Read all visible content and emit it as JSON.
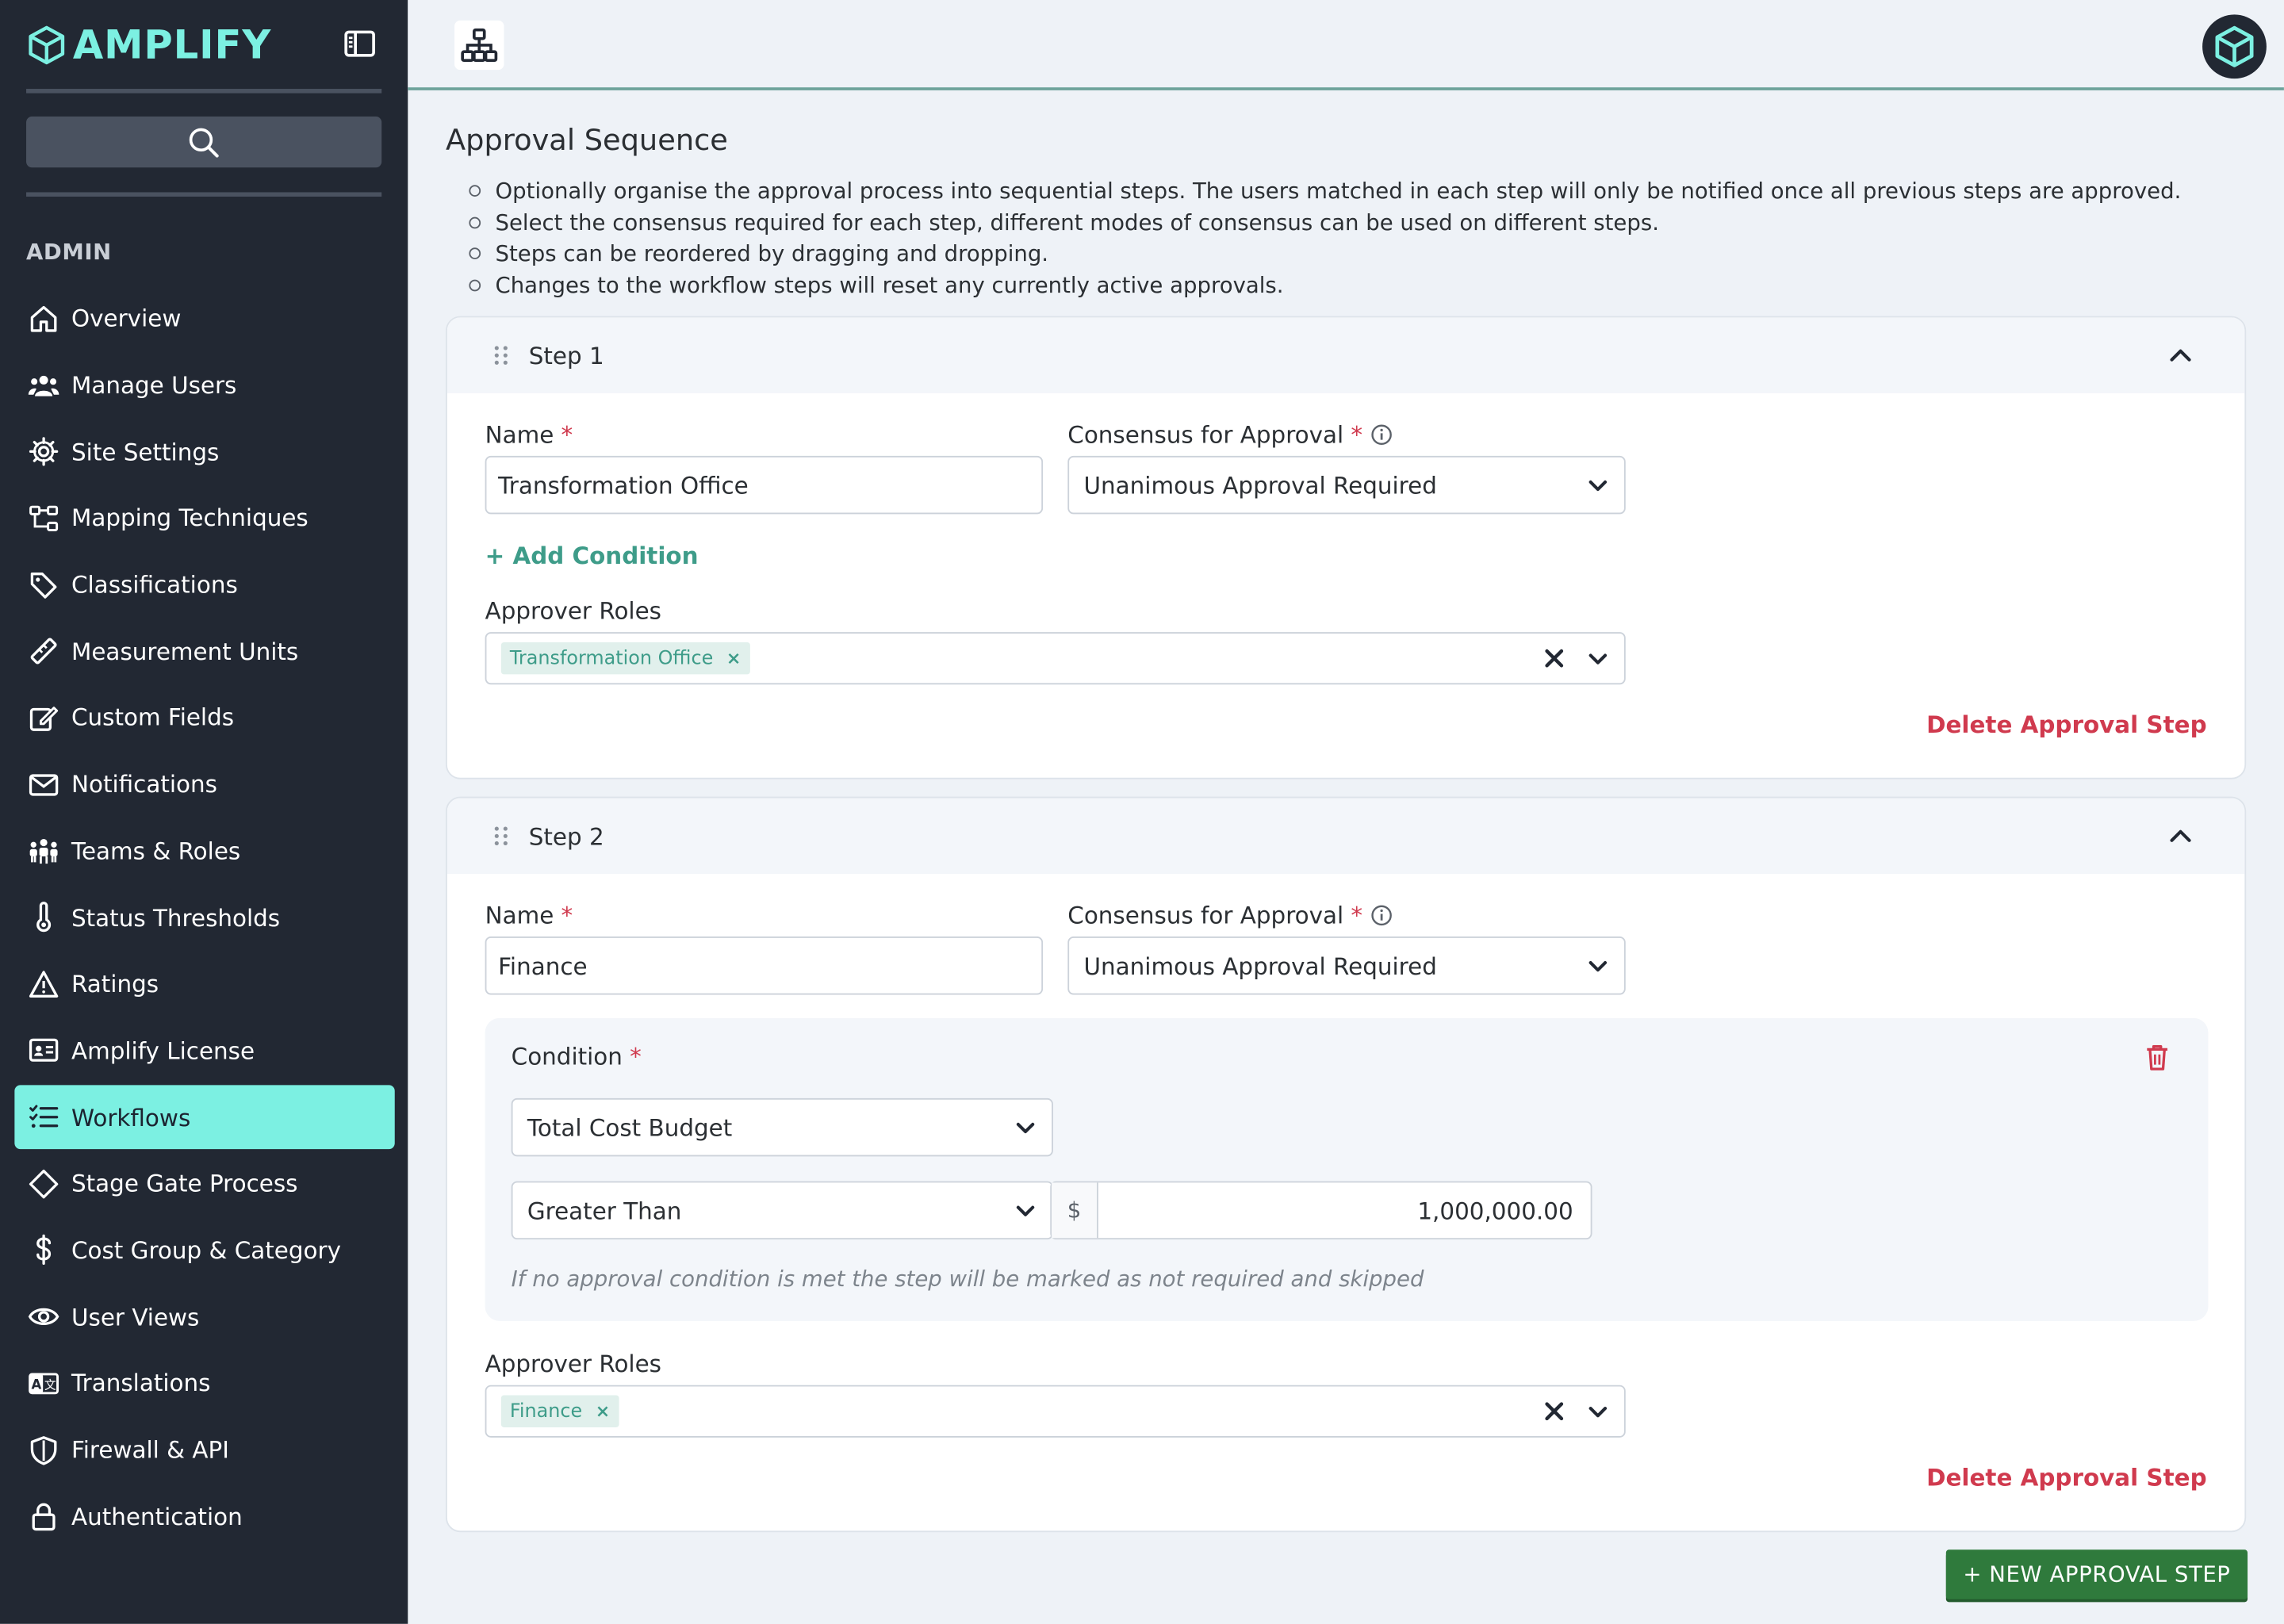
{
  "app": {
    "name": "AMPLIFY",
    "brand_color": "#7cf0e2",
    "accent_green": "#2f7a3c",
    "danger_color": "#d03a4e",
    "link_color": "#3e9c89"
  },
  "sidebar": {
    "section_label": "ADMIN",
    "search_icon": "search-icon",
    "items": [
      {
        "label": "Overview",
        "icon": "home-icon"
      },
      {
        "label": "Manage Users",
        "icon": "users-icon"
      },
      {
        "label": "Site Settings",
        "icon": "gear-icon"
      },
      {
        "label": "Mapping Techniques",
        "icon": "hierarchy-icon"
      },
      {
        "label": "Classifications",
        "icon": "tags-icon"
      },
      {
        "label": "Measurement Units",
        "icon": "ruler-icon"
      },
      {
        "label": "Custom Fields",
        "icon": "edit-icon"
      },
      {
        "label": "Notifications",
        "icon": "envelope-icon"
      },
      {
        "label": "Teams & Roles",
        "icon": "team-icon"
      },
      {
        "label": "Status Thresholds",
        "icon": "thermometer-icon"
      },
      {
        "label": "Ratings",
        "icon": "warning-icon"
      },
      {
        "label": "Amplify License",
        "icon": "id-card-icon"
      },
      {
        "label": "Workflows",
        "icon": "list-check-icon",
        "active": true
      },
      {
        "label": "Stage Gate Process",
        "icon": "diamond-icon"
      },
      {
        "label": "Cost Group & Category",
        "icon": "dollar-icon"
      },
      {
        "label": "User Views",
        "icon": "eye-icon"
      },
      {
        "label": "Translations",
        "icon": "language-icon"
      },
      {
        "label": "Firewall & API",
        "icon": "shield-icon"
      },
      {
        "label": "Authentication",
        "icon": "lock-icon"
      }
    ]
  },
  "topbar": {
    "icon": "sitemap-icon",
    "avatar_icon": "cube-icon"
  },
  "section": {
    "title": "Approval Sequence",
    "bullets": [
      "Optionally organise the approval process into sequential steps. The users matched in each step will only be notified once all previous steps are approved.",
      "Select the consensus required for each step, different modes of consensus can be used on different steps.",
      "Steps can be reordered by dragging and dropping.",
      "Changes to the workflow steps will reset any currently active approvals."
    ]
  },
  "labels": {
    "name": "Name",
    "consensus": "Consensus for Approval",
    "approver_roles": "Approver Roles",
    "required_mark": "*",
    "add_condition": "+ Add Condition",
    "delete_step": "Delete Approval Step",
    "condition": "Condition",
    "tag_remove": "×"
  },
  "steps": [
    {
      "title": "Step 1",
      "name": "Transformation Office",
      "consensus": "Unanimous Approval Required",
      "roles": [
        "Transformation Office"
      ]
    },
    {
      "title": "Step 2",
      "name": "Finance",
      "consensus": "Unanimous Approval Required",
      "roles": [
        "Finance"
      ],
      "condition": {
        "field": "Total Cost Budget",
        "operator": "Greater Than",
        "currency": "$",
        "value": "1,000,000.00",
        "hint": "If no approval condition is met the step will be marked as not required and skipped"
      }
    }
  ],
  "actions": {
    "new_step": "+ NEW APPROVAL STEP"
  }
}
